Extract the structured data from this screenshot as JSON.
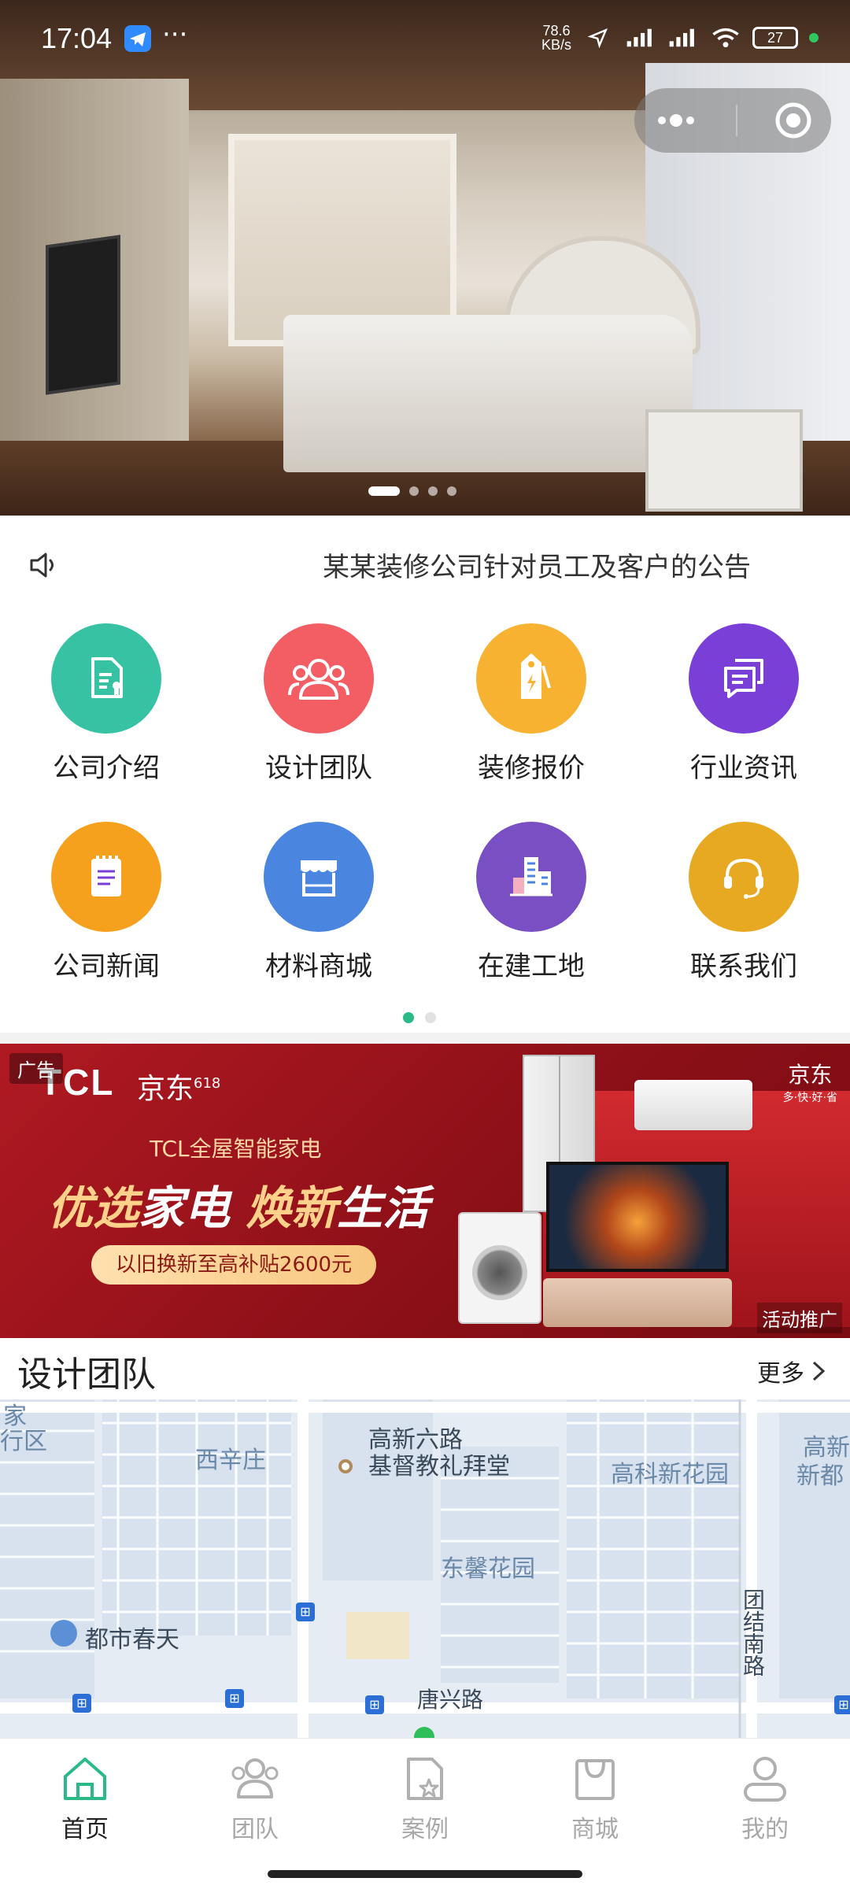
{
  "status_bar": {
    "time": "17:04",
    "more": "···",
    "speed": "78.6\nKB/s",
    "battery": "27"
  },
  "hero": {
    "slides_count": 4,
    "active_slide": 1
  },
  "notice": {
    "text": "某某装修公司针对员工及客户的公告",
    "icon": "speaker-icon"
  },
  "menu": {
    "items": [
      {
        "label": "公司介绍",
        "icon": "document-icon",
        "color": "#36c2a3"
      },
      {
        "label": "设计团队",
        "icon": "people-icon",
        "color": "#f25e63"
      },
      {
        "label": "装修报价",
        "icon": "price-tag-icon",
        "color": "#f7b232"
      },
      {
        "label": "行业资讯",
        "icon": "chat-icon",
        "color": "#7a3fd6"
      },
      {
        "label": "公司新闻",
        "icon": "notepad-icon",
        "color": "#f6a11d"
      },
      {
        "label": "材料商城",
        "icon": "store-icon",
        "color": "#4a86e0"
      },
      {
        "label": "在建工地",
        "icon": "building-icon",
        "color": "#7b4fc4"
      },
      {
        "label": "联系我们",
        "icon": "headset-icon",
        "color": "#e8a922"
      }
    ],
    "pages": 2,
    "active_page": 1
  },
  "ad": {
    "tag": "广告",
    "brand": "TCL",
    "partner": "京东",
    "partner_badge": "618",
    "subtitle": "TCL全屋智能家电",
    "headline_gold_1": "优选",
    "headline_white_1": "家电 ",
    "headline_gold_2": "焕新",
    "headline_white_2": "生活",
    "pill": "以旧换新至高补贴2600元",
    "jd_logo": "京东",
    "jd_slogan": "多·快·好·省",
    "promo": "活动推广"
  },
  "section": {
    "title": "设计团队",
    "more": "更多"
  },
  "map": {
    "labels": [
      {
        "text": "家"
      },
      {
        "text": "行区"
      },
      {
        "text": "西辛庄"
      },
      {
        "text": "高新六路"
      },
      {
        "text": "基督教礼拜堂"
      },
      {
        "text": "高科新花园"
      },
      {
        "text": "高新"
      },
      {
        "text": "新都"
      },
      {
        "text": "东馨花园"
      },
      {
        "text": "都市春天"
      },
      {
        "text": "团结南路"
      },
      {
        "text": "唐兴路"
      }
    ]
  },
  "tabbar": {
    "tabs": [
      {
        "label": "首页",
        "icon": "home-icon",
        "active": true
      },
      {
        "label": "团队",
        "icon": "team-icon",
        "active": false
      },
      {
        "label": "案例",
        "icon": "case-icon",
        "active": false
      },
      {
        "label": "商城",
        "icon": "shop-bag-icon",
        "active": false
      },
      {
        "label": "我的",
        "icon": "user-icon",
        "active": false
      }
    ]
  },
  "colors": {
    "accent": "#2aba87",
    "ad_red": "#b01922"
  }
}
